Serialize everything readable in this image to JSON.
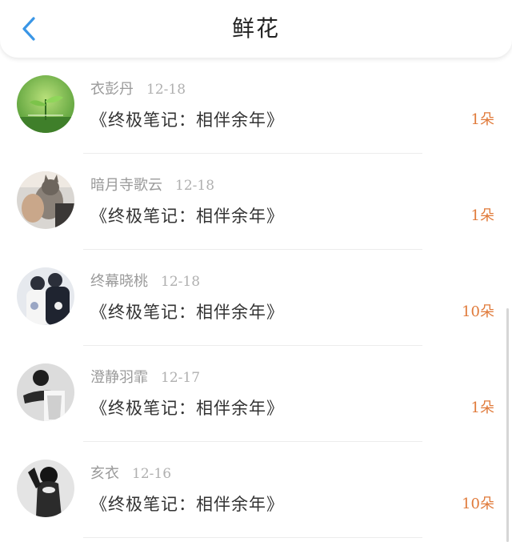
{
  "header": {
    "title": "鲜花",
    "back_icon": "chevron-left-icon",
    "accent": "#3a96e6"
  },
  "items": [
    {
      "user": "衣彭丹",
      "date": "12-18",
      "book": "《终极笔记：相伴余年》",
      "count": "1朵"
    },
    {
      "user": "暗月寺歌云",
      "date": "12-18",
      "book": "《终极笔记：相伴余年》",
      "count": "1朵"
    },
    {
      "user": "终幕晓桃",
      "date": "12-18",
      "book": "《终极笔记：相伴余年》",
      "count": "10朵"
    },
    {
      "user": "澄静羽霏",
      "date": "12-17",
      "book": "《终极笔记：相伴余年》",
      "count": "1朵"
    },
    {
      "user": "亥衣",
      "date": "12-16",
      "book": "《终极笔记：相伴余年》",
      "count": "10朵"
    }
  ],
  "colors": {
    "count": "#e07a3a",
    "meta": "#9a9a9a",
    "book": "#333333"
  }
}
